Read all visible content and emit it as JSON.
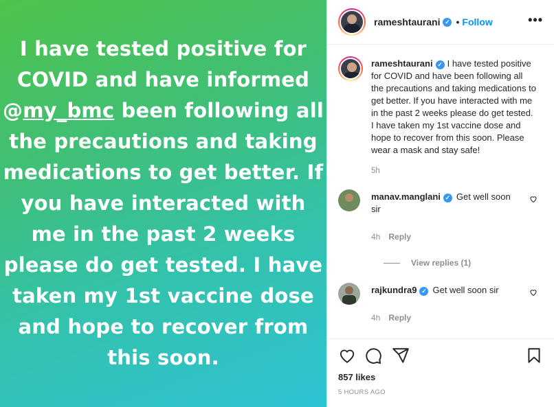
{
  "story": {
    "text_before_mention": "I have tested positive for COVID and have informed @",
    "mention": "my_bmc",
    "text_after_mention": "been following all the precautions and taking medications to get better. If you have interacted with me in the past 2 weeks please do get tested. I have taken my 1st vaccine dose and hope to recover from this soon."
  },
  "header": {
    "username": "rameshtaurani",
    "separator": "•",
    "follow_label": "Follow",
    "more_label": "•••"
  },
  "caption": {
    "username": "rameshtaurani",
    "text": "I have tested positive for COVID and have been following all the precautions and taking medications to get better. If you have interacted with me in the past 2 weeks please do get tested. I have taken my 1st vaccine dose and hope to recover from this soon. Please wear a mask and stay safe!",
    "time": "5h"
  },
  "comments": [
    {
      "username": "manav.manglani",
      "text": "Get well soon sir",
      "time": "4h",
      "reply_label": "Reply",
      "view_replies": "View replies (1)"
    },
    {
      "username": "rajkundra9",
      "text": "Get well soon sir",
      "time": "4h",
      "reply_label": "Reply"
    }
  ],
  "footer": {
    "likes": "857 likes",
    "posted": "5 HOURS AGO"
  },
  "icons": {
    "verified": "verified-badge-icon",
    "like": "heart-icon",
    "comment": "comment-icon",
    "share": "share-icon",
    "save": "bookmark-icon"
  },
  "colors": {
    "accent": "#0095f6",
    "verified": "#3897f0",
    "muted": "#8e8e8e"
  }
}
